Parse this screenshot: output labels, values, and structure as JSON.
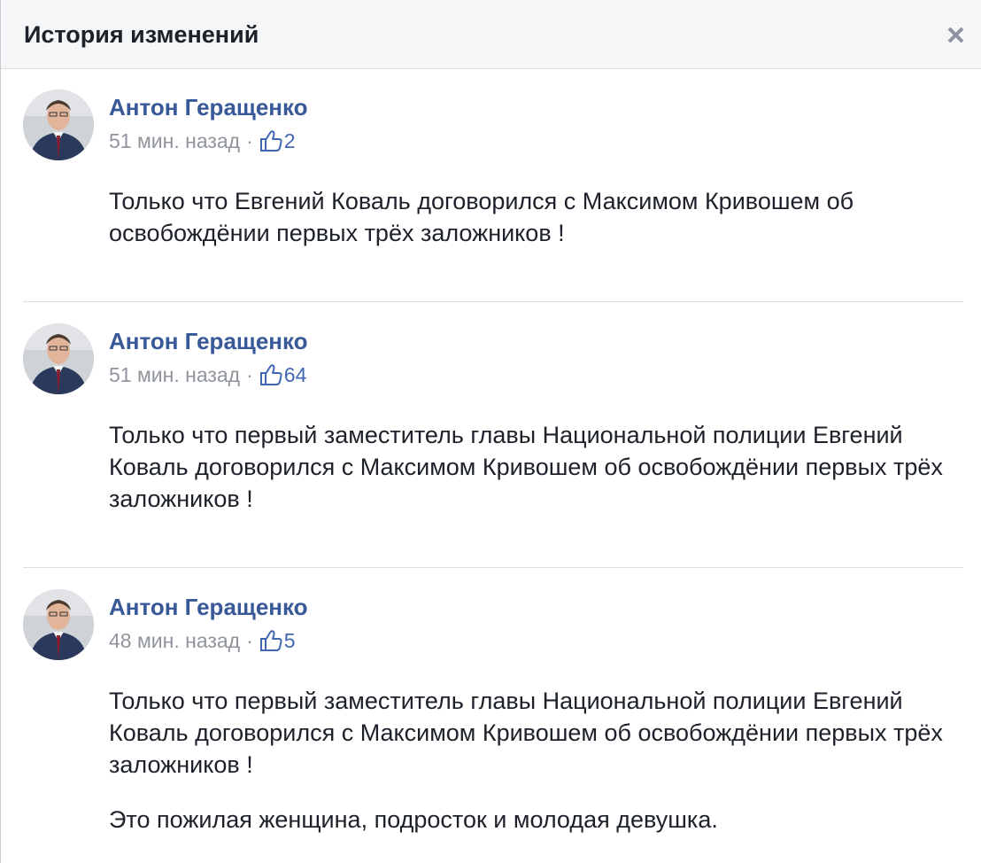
{
  "dialog": {
    "title": "История изменений"
  },
  "entries": [
    {
      "author": "Антон Геращенко",
      "time": "51 мин. назад",
      "separator": "·",
      "likes": "2",
      "paragraphs": [
        "Только что Евгений Коваль договорился с Максимом Кривошем об освобождёнии первых трёх заложников !"
      ]
    },
    {
      "author": "Антон Геращенко",
      "time": "51 мин. назад",
      "separator": "·",
      "likes": "64",
      "paragraphs": [
        "Только что первый заместитель главы Национальной полиции Евгений Коваль договорился с Максимом Кривошем об освобождёнии первых трёх заложников !"
      ]
    },
    {
      "author": "Антон Геращенко",
      "time": "48 мин. назад",
      "separator": "·",
      "likes": "5",
      "paragraphs": [
        "Только что первый заместитель главы Национальной полиции Евгений Коваль договорился с Максимом Кривошем об освобождёнии первых трёх заложников !",
        "Это пожилая женщина, подросток и молодая девушка."
      ]
    }
  ],
  "icons": {
    "close": "close-icon",
    "like": "like-icon",
    "avatar": "avatar-photo"
  },
  "colors": {
    "header_bg": "#f5f6f7",
    "author": "#385898",
    "meta": "#90949c",
    "like": "#4267b2",
    "text": "#1d2129",
    "divider": "#dddfe2"
  }
}
